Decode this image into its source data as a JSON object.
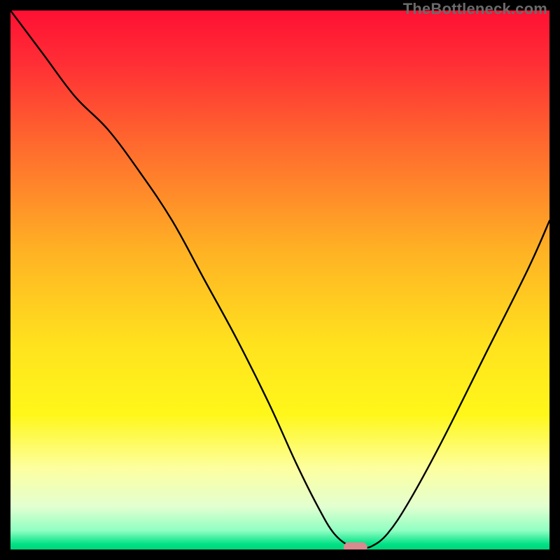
{
  "watermark": "TheBottleneck.com",
  "chart_data": {
    "type": "line",
    "title": "",
    "xlabel": "",
    "ylabel": "",
    "xlim": [
      0,
      100
    ],
    "ylim": [
      0,
      100
    ],
    "curve": {
      "name": "bottleneck-curve",
      "x": [
        0,
        6,
        12,
        18,
        24,
        30,
        36,
        42,
        48,
        53,
        57,
        60,
        63,
        65,
        67,
        70,
        74,
        80,
        88,
        96,
        100
      ],
      "y": [
        100,
        92,
        84,
        78,
        70,
        61,
        50,
        39,
        27,
        16,
        8,
        3,
        0.6,
        0.4,
        0.6,
        3,
        9,
        20,
        36,
        52,
        61
      ]
    },
    "marker": {
      "name": "optimal-point",
      "x": 64,
      "y": 0.4,
      "color": "#d88a8f",
      "shape": "pill"
    },
    "background_gradient": {
      "stops": [
        {
          "offset": 0.0,
          "color": "#ff1034"
        },
        {
          "offset": 0.1,
          "color": "#ff2f35"
        },
        {
          "offset": 0.25,
          "color": "#ff6a2e"
        },
        {
          "offset": 0.45,
          "color": "#ffb324"
        },
        {
          "offset": 0.62,
          "color": "#ffe21e"
        },
        {
          "offset": 0.75,
          "color": "#fff71a"
        },
        {
          "offset": 0.85,
          "color": "#fdffa0"
        },
        {
          "offset": 0.92,
          "color": "#e3ffd0"
        },
        {
          "offset": 0.965,
          "color": "#8fffc2"
        },
        {
          "offset": 0.99,
          "color": "#00e185"
        },
        {
          "offset": 1.0,
          "color": "#00d47a"
        }
      ]
    }
  }
}
